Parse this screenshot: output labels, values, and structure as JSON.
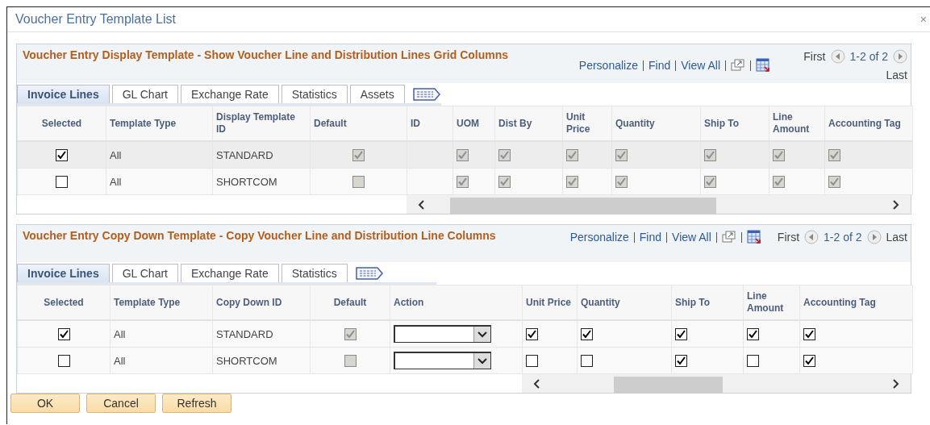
{
  "window": {
    "title": "Voucher Entry Template List",
    "close": "×"
  },
  "grids": [
    {
      "title": "Voucher Entry Display Template - Show Voucher Line and Distribution Lines Grid Columns",
      "links": [
        "Personalize",
        "Find",
        "View All"
      ],
      "nav": {
        "first": "First",
        "range": "1-2 of 2",
        "last": "Last"
      },
      "tabs": [
        {
          "label": "Invoice Lines",
          "selected": true
        },
        {
          "label": "GL Chart",
          "selected": false
        },
        {
          "label": "Exchange Rate",
          "selected": false
        },
        {
          "label": "Statistics",
          "selected": false
        },
        {
          "label": "Assets",
          "selected": false
        }
      ],
      "columns": [
        "Selected",
        "Template Type",
        "Display Template ID",
        "Default",
        "ID",
        "UOM",
        "Dist By",
        "Unit Price",
        "Quantity",
        "Ship To",
        "Line Amount",
        "Accounting Tag"
      ],
      "rows": [
        {
          "selected": true,
          "cells": [
            {
              "kind": "checkbox",
              "checked": true,
              "disabled": false
            },
            {
              "kind": "text",
              "text": "All"
            },
            {
              "kind": "text",
              "text": "STANDARD"
            },
            {
              "kind": "checkbox",
              "checked": true,
              "disabled": true
            },
            {
              "kind": "blank"
            },
            {
              "kind": "checkbox",
              "checked": true,
              "disabled": true
            },
            {
              "kind": "checkbox",
              "checked": true,
              "disabled": true
            },
            {
              "kind": "checkbox",
              "checked": true,
              "disabled": true
            },
            {
              "kind": "checkbox",
              "checked": true,
              "disabled": true
            },
            {
              "kind": "checkbox",
              "checked": true,
              "disabled": true
            },
            {
              "kind": "checkbox",
              "checked": true,
              "disabled": true
            },
            {
              "kind": "checkbox",
              "checked": true,
              "disabled": true
            }
          ]
        },
        {
          "selected": false,
          "cells": [
            {
              "kind": "checkbox",
              "checked": false,
              "disabled": false
            },
            {
              "kind": "text",
              "text": "All"
            },
            {
              "kind": "text",
              "text": "SHORTCOM"
            },
            {
              "kind": "checkbox",
              "checked": false,
              "disabled": true
            },
            {
              "kind": "blank"
            },
            {
              "kind": "checkbox",
              "checked": true,
              "disabled": true
            },
            {
              "kind": "checkbox",
              "checked": true,
              "disabled": true
            },
            {
              "kind": "checkbox",
              "checked": true,
              "disabled": true
            },
            {
              "kind": "checkbox",
              "checked": true,
              "disabled": true
            },
            {
              "kind": "checkbox",
              "checked": true,
              "disabled": true
            },
            {
              "kind": "checkbox",
              "checked": true,
              "disabled": true
            },
            {
              "kind": "checkbox",
              "checked": true,
              "disabled": true
            }
          ]
        }
      ]
    },
    {
      "title": "Voucher Entry Copy Down Template - Copy Voucher Line and Distribution Line Columns",
      "links": [
        "Personalize",
        "Find",
        "View All"
      ],
      "nav": {
        "first": "First",
        "range": "1-2 of 2",
        "last": "Last"
      },
      "tabs": [
        {
          "label": "Invoice Lines",
          "selected": true
        },
        {
          "label": "GL Chart",
          "selected": false
        },
        {
          "label": "Exchange Rate",
          "selected": false
        },
        {
          "label": "Statistics",
          "selected": false
        }
      ],
      "columns": [
        "Selected",
        "Template Type",
        "Copy Down ID",
        "Default",
        "Action",
        "Unit Price",
        "Quantity",
        "Ship To",
        "Line Amount",
        "Accounting Tag"
      ],
      "rows": [
        {
          "selected": false,
          "cells": [
            {
              "kind": "checkbox",
              "checked": true,
              "disabled": false
            },
            {
              "kind": "text",
              "text": "All"
            },
            {
              "kind": "text",
              "text": "STANDARD"
            },
            {
              "kind": "checkbox",
              "checked": true,
              "disabled": true
            },
            {
              "kind": "dropdown"
            },
            {
              "kind": "checkbox",
              "checked": true,
              "disabled": false
            },
            {
              "kind": "checkbox",
              "checked": true,
              "disabled": false
            },
            {
              "kind": "checkbox",
              "checked": true,
              "disabled": false
            },
            {
              "kind": "checkbox",
              "checked": true,
              "disabled": false
            },
            {
              "kind": "checkbox",
              "checked": true,
              "disabled": false
            }
          ]
        },
        {
          "selected": false,
          "cells": [
            {
              "kind": "checkbox",
              "checked": false,
              "disabled": false
            },
            {
              "kind": "text",
              "text": "All"
            },
            {
              "kind": "text",
              "text": "SHORTCOM"
            },
            {
              "kind": "checkbox",
              "checked": false,
              "disabled": true
            },
            {
              "kind": "dropdown"
            },
            {
              "kind": "checkbox",
              "checked": false,
              "disabled": false
            },
            {
              "kind": "checkbox",
              "checked": false,
              "disabled": false
            },
            {
              "kind": "checkbox",
              "checked": true,
              "disabled": false
            },
            {
              "kind": "checkbox",
              "checked": false,
              "disabled": false
            },
            {
              "kind": "checkbox",
              "checked": true,
              "disabled": false
            }
          ]
        }
      ]
    }
  ],
  "buttons": [
    "OK",
    "Cancel",
    "Refresh"
  ]
}
